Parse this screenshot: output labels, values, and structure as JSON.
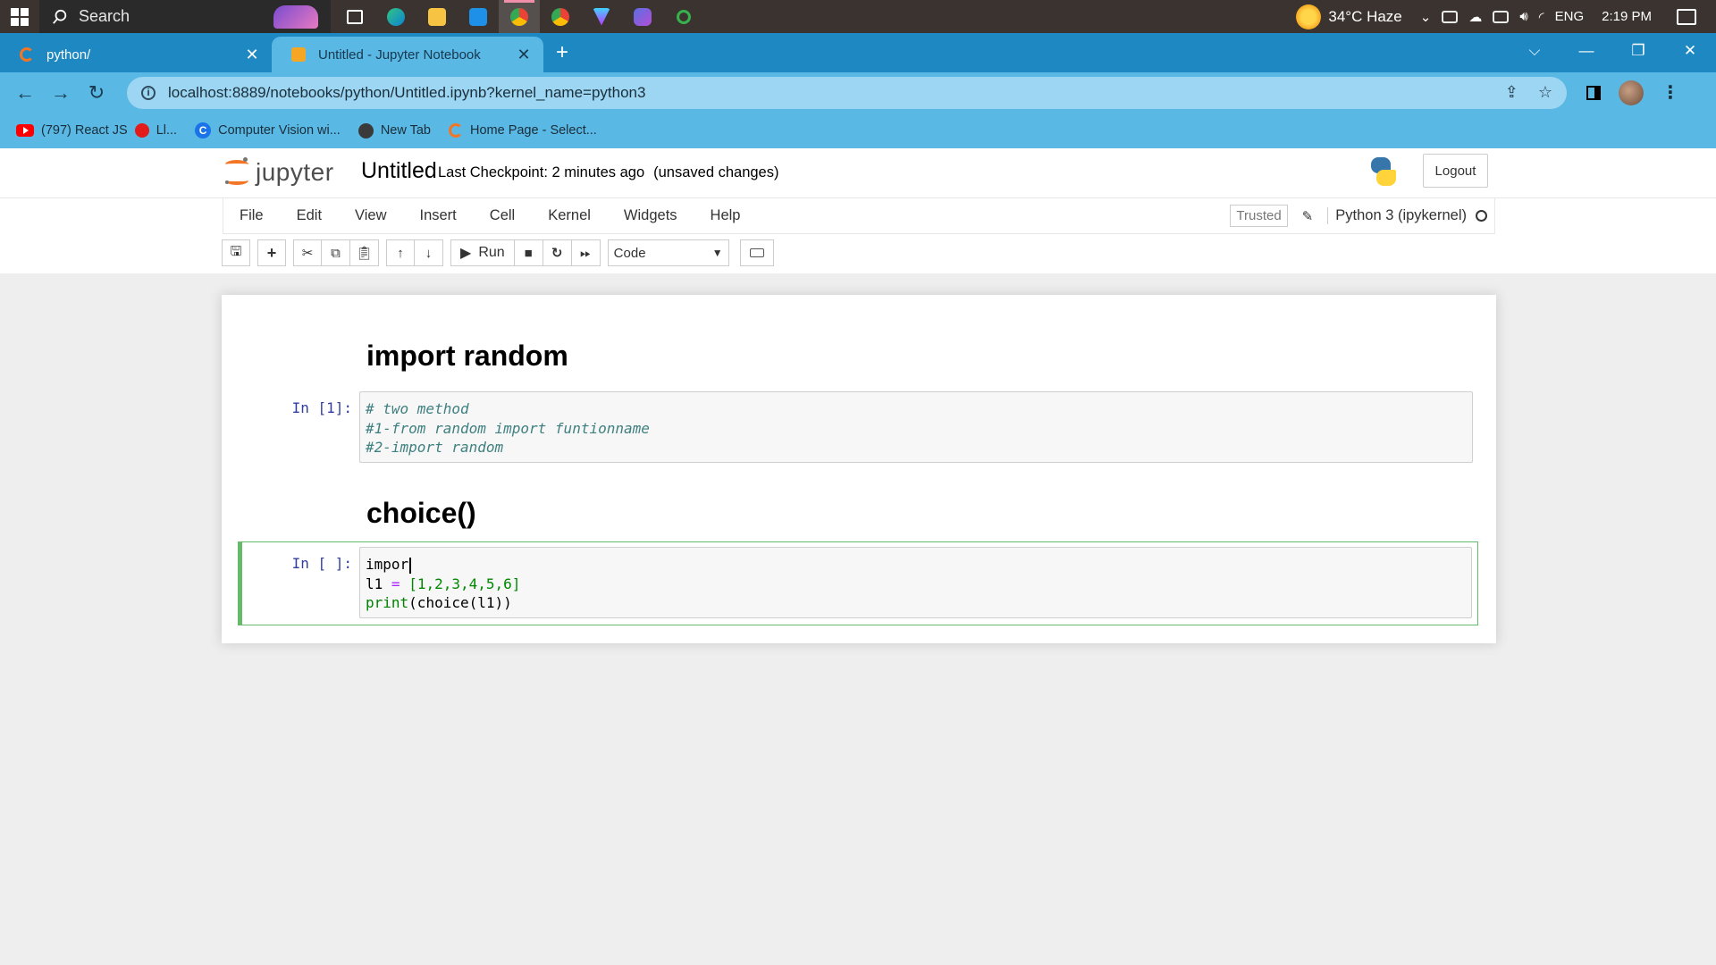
{
  "taskbar": {
    "search_label": "Search",
    "weather": "34°C  Haze",
    "language": "ENG",
    "time": "2:19 PM"
  },
  "tabs": [
    {
      "title": "python/"
    },
    {
      "title": "Untitled - Jupyter Notebook"
    }
  ],
  "address": {
    "url": "localhost:8889/notebooks/python/Untitled.ipynb?kernel_name=python3"
  },
  "bookmarks": [
    {
      "label": "(797) React JS"
    },
    {
      "label": "Ll..."
    },
    {
      "label": "Computer Vision wi..."
    },
    {
      "label": "New Tab"
    },
    {
      "label": "Home Page - Select..."
    }
  ],
  "jupyter": {
    "logo_text": "jupyter",
    "notebook_name": "Untitled",
    "checkpoint": "Last Checkpoint: 2 minutes ago",
    "unsaved": "(unsaved changes)",
    "logout": "Logout",
    "menu": [
      "File",
      "Edit",
      "View",
      "Insert",
      "Cell",
      "Kernel",
      "Widgets",
      "Help"
    ],
    "trusted": "Trusted",
    "kernel": "Python 3 (ipykernel)",
    "run_label": "Run",
    "cell_type": "Code"
  },
  "cells": {
    "md1": "import random",
    "code1_prompt": "In [1]:",
    "code1_lines": [
      "# two method",
      "#1-from random import funtionname",
      "#2-import random"
    ],
    "md2": "choice()",
    "code2_prompt": "In [ ]:",
    "code2_line1": "impor",
    "code2_line2_var": "l1",
    "code2_line2_op": "=",
    "code2_line2_list": "[1,2,3,4,5,6]",
    "code2_line3_fn": "print",
    "code2_line3_args": "(choice(l1))"
  }
}
